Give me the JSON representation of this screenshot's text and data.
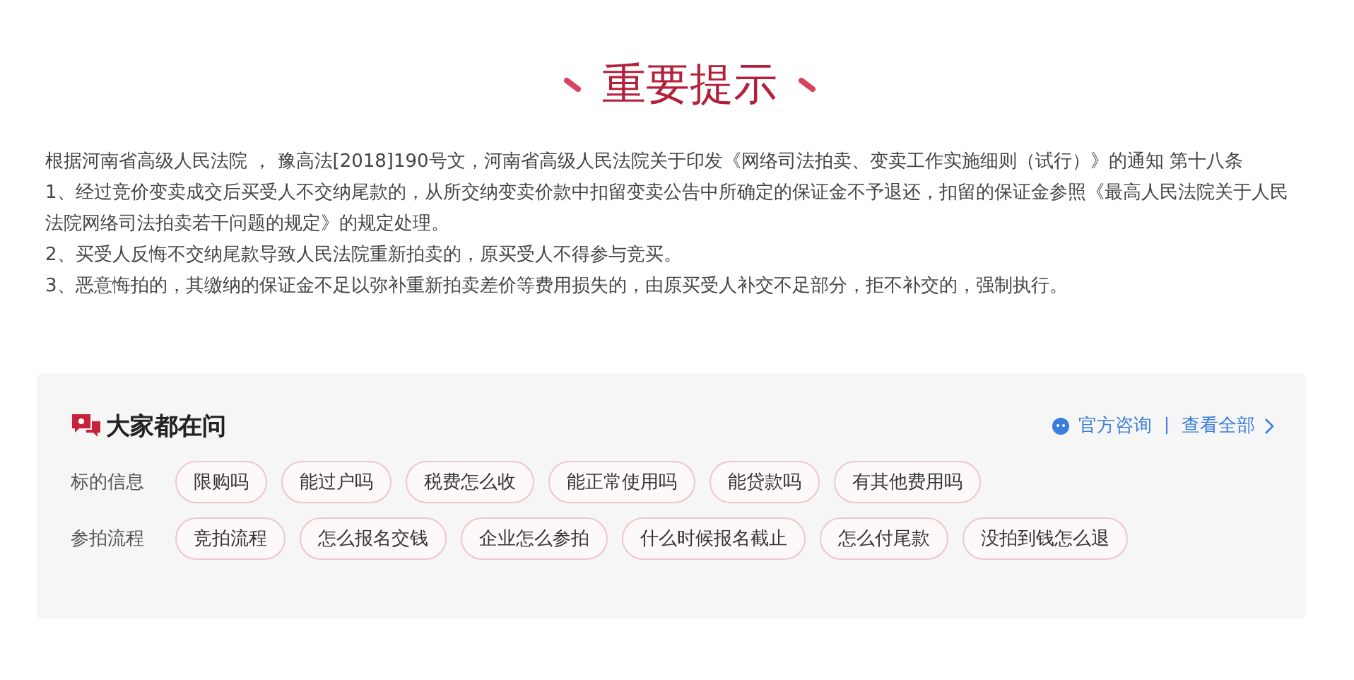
{
  "title": "重要提示",
  "notice": [
    "根据河南省高级人民法院 ， 豫高法[2018]190号文，河南省高级人民法院关于印发《网络司法拍卖、变卖工作实施细则（试行）》的通知 第十八条",
    "1、经过竞价变卖成交后买受人不交纳尾款的，从所交纳变卖价款中扣留变卖公告中所确定的保证金不予退还，扣留的保证金参照《最高人民法院关于人民法院网络司法拍卖若干问题的规定》的规定处理。",
    "2、买受人反悔不交纳尾款导致人民法院重新拍卖的，原买受人不得参与竞买。",
    "3、恶意悔拍的，其缴纳的保证金不足以弥补重新拍卖差价等费用损失的，由原买受人补交不足部分，拒不补交的，强制执行。"
  ],
  "faq": {
    "heading": "大家都在问",
    "consult_link": "官方咨询",
    "view_all_link": "查看全部",
    "groups": [
      {
        "label": "标的信息",
        "tags": [
          "限购吗",
          "能过户吗",
          "税费怎么收",
          "能正常使用吗",
          "能贷款吗",
          "有其他费用吗"
        ]
      },
      {
        "label": "参拍流程",
        "tags": [
          "竞拍流程",
          "怎么报名交钱",
          "企业怎么参拍",
          "什么时候报名截止",
          "怎么付尾款",
          "没拍到钱怎么退"
        ]
      }
    ]
  }
}
